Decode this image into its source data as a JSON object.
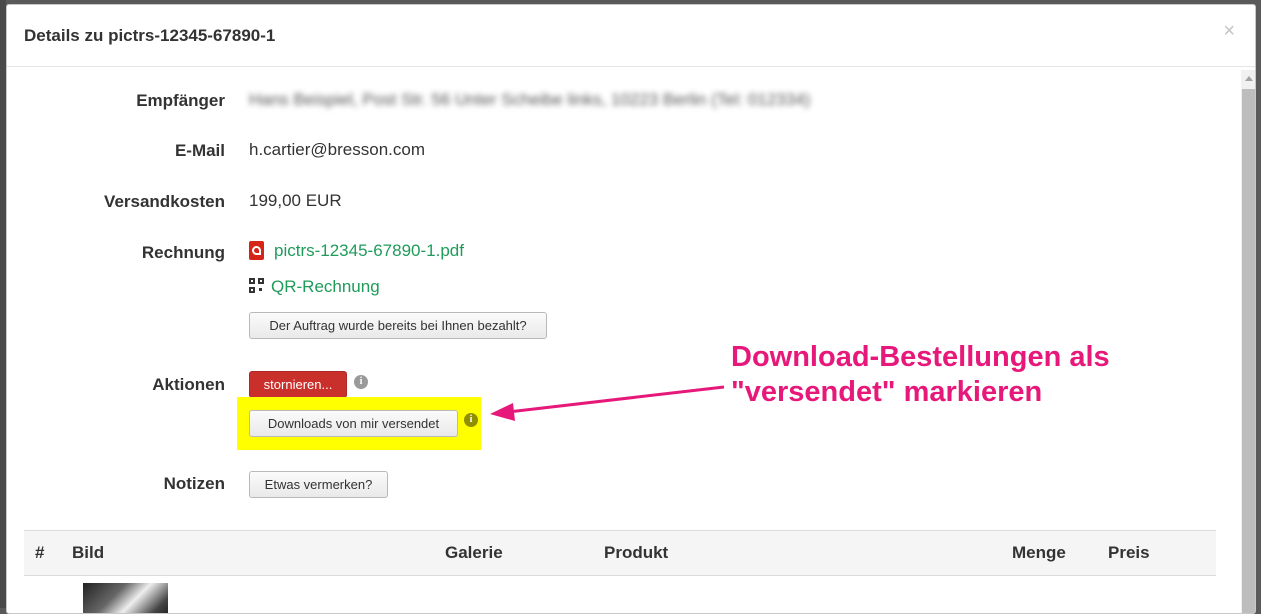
{
  "modal": {
    "title": "Details zu pictrs-12345-67890-1",
    "close_symbol": "×"
  },
  "fields": {
    "recipient_label": "Empfänger",
    "recipient_value": "Hans Beispiel, Post Str. 56 Unter Scheibe links, 10223 Berlin (Tel: 012334)",
    "email_label": "E-Mail",
    "email_value": "h.cartier@bresson.com",
    "shipping_label": "Versandkosten",
    "shipping_value": "199,00 EUR",
    "invoice_label": "Rechnung",
    "invoice_pdf_link": "pictrs-12345-67890-1.pdf",
    "invoice_qr_link": "QR-Rechnung",
    "paid_button": "Der Auftrag wurde bereits bei Ihnen bezahlt?",
    "actions_label": "Aktionen",
    "cancel_button": "stornieren...",
    "downloads_button": "Downloads von mir versendet",
    "notes_label": "Notizen",
    "notes_button": "Etwas vermerken?"
  },
  "annotation": {
    "text": "Download-Bestellungen als\n\"versendet\" markieren",
    "color": "#e6197a"
  },
  "table": {
    "headers": [
      "#",
      "Bild",
      "Galerie",
      "Produkt",
      "Menge",
      "Preis"
    ]
  },
  "colors": {
    "link": "#1f9b5a",
    "danger": "#c9302c",
    "highlight": "#ffff00"
  },
  "icons": {
    "pdf": "pdf-icon",
    "qr": "qr-code-icon",
    "info": "info-icon",
    "close": "close-icon"
  }
}
